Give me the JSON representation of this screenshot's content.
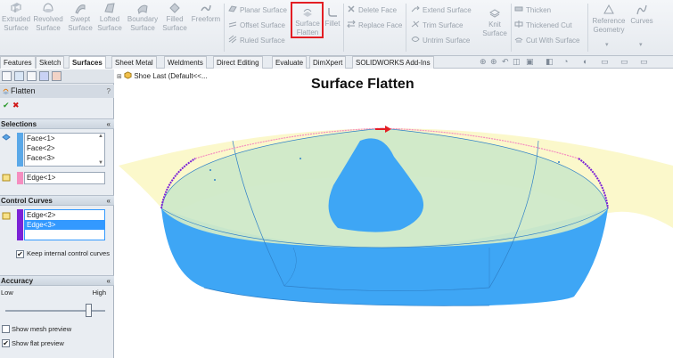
{
  "ribbon": {
    "large_buttons": [
      {
        "id": "extruded",
        "label": "Extruded\nSurface",
        "icon": "extruded-surface-icon"
      },
      {
        "id": "revolved",
        "label": "Revolved\nSurface",
        "icon": "revolved-surface-icon"
      },
      {
        "id": "swept",
        "label": "Swept\nSurface",
        "icon": "swept-surface-icon"
      },
      {
        "id": "lofted",
        "label": "Lofted\nSurface",
        "icon": "lofted-surface-icon"
      },
      {
        "id": "boundary",
        "label": "Boundary\nSurface",
        "icon": "boundary-surface-icon"
      },
      {
        "id": "filled",
        "label": "Filled\nSurface",
        "icon": "filled-surface-icon"
      },
      {
        "id": "freeform",
        "label": "Freeform",
        "icon": "freeform-icon"
      },
      {
        "id": "flatten",
        "label": "Surface\nFlatten",
        "icon": "surface-flatten-icon"
      },
      {
        "id": "fillet",
        "label": "Fillet",
        "icon": "fillet-icon"
      },
      {
        "id": "knit",
        "label": "Knit\nSurface",
        "icon": "knit-surface-icon"
      },
      {
        "id": "refgeom",
        "label": "Reference\nGeometry",
        "icon": "reference-geometry-icon"
      },
      {
        "id": "curves",
        "label": "Curves",
        "icon": "curves-icon"
      }
    ],
    "small_buttons": [
      {
        "id": "planar",
        "label": "Planar Surface",
        "icon": "planar-surface-icon"
      },
      {
        "id": "offset",
        "label": "Offset Surface",
        "icon": "offset-surface-icon"
      },
      {
        "id": "ruled",
        "label": "Ruled Surface",
        "icon": "ruled-surface-icon"
      },
      {
        "id": "delete",
        "label": "Delete Face",
        "icon": "delete-face-icon"
      },
      {
        "id": "replace",
        "label": "Replace Face",
        "icon": "replace-face-icon"
      },
      {
        "id": "extend",
        "label": "Extend Surface",
        "icon": "extend-surface-icon"
      },
      {
        "id": "trim",
        "label": "Trim Surface",
        "icon": "trim-surface-icon"
      },
      {
        "id": "untrim",
        "label": "Untrim Surface",
        "icon": "untrim-surface-icon"
      },
      {
        "id": "thicken",
        "label": "Thicken",
        "icon": "thicken-icon"
      },
      {
        "id": "thickcut",
        "label": "Thickened Cut",
        "icon": "thickened-cut-icon"
      },
      {
        "id": "cutwith",
        "label": "Cut With Surface",
        "icon": "cut-with-surface-icon"
      }
    ]
  },
  "tabs": [
    "Features",
    "Sketch",
    "Surfaces",
    "Sheet Metal",
    "Weldments",
    "Direct Editing",
    "Evaluate",
    "DimXpert",
    "SOLIDWORKS Add-Ins"
  ],
  "active_tab": "Surfaces",
  "panel": {
    "title": "Flatten",
    "help": "?",
    "ok": "✔",
    "cancel": "✖",
    "selections": {
      "header": "Selections",
      "faces": [
        "Face<1>",
        "Face<2>",
        "Face<3>"
      ],
      "edge": "Edge<1>"
    },
    "control_curves": {
      "header": "Control Curves",
      "edges": [
        "Edge<2>",
        "Edge<3>"
      ],
      "keep_internal": "Keep internal control curves"
    },
    "accuracy": {
      "header": "Accuracy",
      "low": "Low",
      "high": "High",
      "level": 0.86,
      "show_mesh": "Show mesh preview",
      "show_flat": "Show flat preview"
    },
    "chevron": "«"
  },
  "viewport": {
    "tree_item": "Shoe Last  (Default<<...",
    "title": "Surface Flatten"
  },
  "colors": {
    "face_blue": "#3ea6f5",
    "face_green": "#cfe9c8",
    "flat_yellow": "#fbf8c8",
    "edge_pink": "#f58ec0",
    "curve_purple": "#7b22d6",
    "highlight_red": "#e31e24",
    "selection_blue": "#3399ff"
  }
}
